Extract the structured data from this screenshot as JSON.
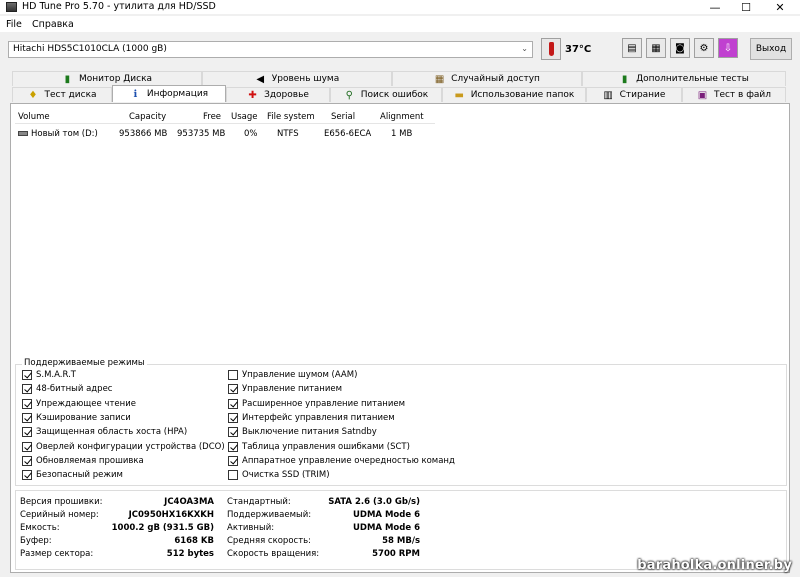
{
  "window": {
    "title": "HD Tune Pro 5.70 - утилита для HD/SSD"
  },
  "menu": {
    "file": "File",
    "help": "Справка"
  },
  "toolbar": {
    "drive": "Hitachi HDS5C1010CLA (1000 gB)",
    "temperature": "37°C",
    "exit_label": "Выход"
  },
  "tabs": {
    "row1": [
      {
        "label": "Монитор Диска",
        "icon": "monitor-icon"
      },
      {
        "label": "Уровень шума",
        "icon": "speaker-icon"
      },
      {
        "label": "Случайный доступ",
        "icon": "random-icon"
      },
      {
        "label": "Дополнительные  тесты",
        "icon": "extra-tests-icon"
      }
    ],
    "row2": [
      {
        "label": "Тест диска",
        "icon": "bulb-icon"
      },
      {
        "label": "Информация",
        "icon": "info-icon",
        "active": true
      },
      {
        "label": "Здоровье",
        "icon": "health-cross-icon"
      },
      {
        "label": "Поиск ошибок",
        "icon": "magnifier-icon"
      },
      {
        "label": "Использование папок",
        "icon": "folder-icon"
      },
      {
        "label": "Стирание",
        "icon": "trash-icon"
      },
      {
        "label": "Тест в файл",
        "icon": "file-test-icon"
      }
    ]
  },
  "volumes": {
    "headers": [
      "Volume",
      "Capacity",
      "Free",
      "Usage",
      "File system",
      "Serial",
      "Alignment"
    ],
    "rows": [
      [
        "Новый том (D:)",
        "953866 MB",
        "953735 MB",
        "0%",
        "NTFS",
        "E656-6ECA",
        "1 MB"
      ]
    ]
  },
  "features": {
    "title": "Поддерживаемые режимы",
    "left": [
      {
        "label": "S.M.A.R.T",
        "checked": true
      },
      {
        "label": "48-битный адрес",
        "checked": true
      },
      {
        "label": "Упреждающее чтение",
        "checked": true
      },
      {
        "label": "Кэширование записи",
        "checked": true
      },
      {
        "label": "Защищенная область хоста (HPA)",
        "checked": true
      },
      {
        "label": "Оверлей конфигурации устройства (DCO)",
        "checked": true
      },
      {
        "label": "Обновляемая прошивка",
        "checked": true
      },
      {
        "label": "Безопасный режим",
        "checked": true
      }
    ],
    "right": [
      {
        "label": "Управление шумом (AAM)",
        "checked": false
      },
      {
        "label": "Управление питанием",
        "checked": true
      },
      {
        "label": "Расширенное управление питанием",
        "checked": true
      },
      {
        "label": "Интерфейс управления питанием",
        "checked": true
      },
      {
        "label": "Выключение питания Satndby",
        "checked": true
      },
      {
        "label": "Таблица управления ошибками (SCT)",
        "checked": true
      },
      {
        "label": "Аппаратное управление очередностью команд",
        "checked": true
      },
      {
        "label": "Очистка SSD (TRIM)",
        "checked": false
      }
    ]
  },
  "info": {
    "left": [
      {
        "label": "Версия прошивки:",
        "value": "JC4OA3MA"
      },
      {
        "label": "Серийный номер:",
        "value": "JC0950HX16KXKH"
      },
      {
        "label": "Емкость:",
        "value": "1000.2 gB (931.5 GB)"
      },
      {
        "label": "Буфер:",
        "value": "6168 KB"
      },
      {
        "label": "Размер сектора:",
        "value": "512 bytes"
      }
    ],
    "right": [
      {
        "label": "Стандартный:",
        "value": "SATA 2.6 (3.0 Gb/s)"
      },
      {
        "label": "Поддерживаемый:",
        "value": "UDMA Mode 6"
      },
      {
        "label": "Активный:",
        "value": "UDMA Mode 6"
      },
      {
        "label": "Средняя скорость:",
        "value": "58 MB/s"
      },
      {
        "label": "Скорость вращения:",
        "value": "5700 RPM"
      }
    ]
  },
  "watermark": "baraholka.onliner.by"
}
